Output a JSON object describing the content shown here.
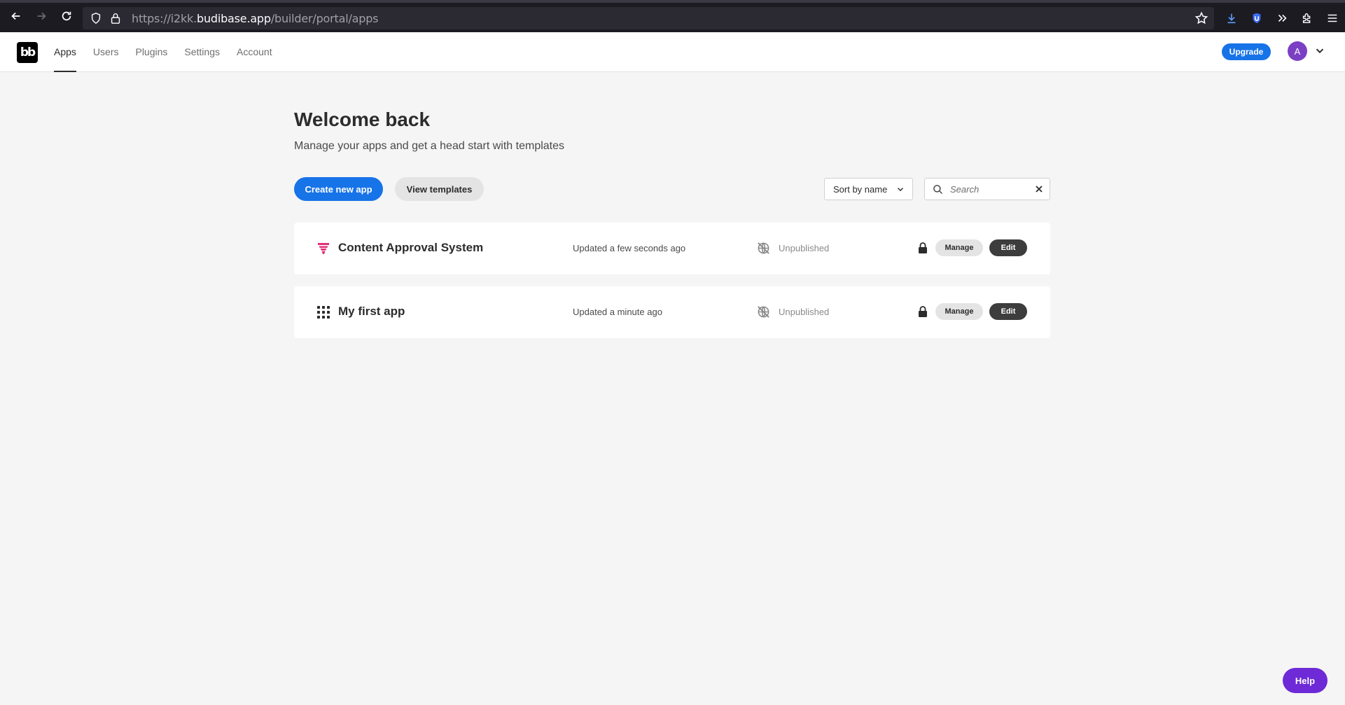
{
  "browser": {
    "url_prefix": "https://i2kk.",
    "url_host": "budibase.app",
    "url_path": "/builder/portal/apps"
  },
  "nav": {
    "logo_text": "bb",
    "items": [
      {
        "label": "Apps",
        "active": true
      },
      {
        "label": "Users",
        "active": false
      },
      {
        "label": "Plugins",
        "active": false
      },
      {
        "label": "Settings",
        "active": false
      },
      {
        "label": "Account",
        "active": false
      }
    ],
    "upgrade_label": "Upgrade",
    "avatar_initial": "A"
  },
  "page": {
    "title": "Welcome back",
    "subtitle": "Manage your apps and get a head start with templates",
    "create_label": "Create new app",
    "templates_label": "View templates",
    "sort_label": "Sort by name",
    "search_placeholder": "Search"
  },
  "apps": [
    {
      "name": "Content Approval System",
      "updated": "Updated a few seconds ago",
      "status": "Unpublished",
      "icon": "funnel-icon",
      "icon_color": "#e0317b",
      "manage_label": "Manage",
      "edit_label": "Edit"
    },
    {
      "name": "My first app",
      "updated": "Updated a minute ago",
      "status": "Unpublished",
      "icon": "grid-dots-icon",
      "icon_color": "#2c2c2c",
      "manage_label": "Manage",
      "edit_label": "Edit"
    }
  ],
  "help_label": "Help",
  "colors": {
    "accent": "#1773e8",
    "help": "#6d2ad6",
    "avatar": "#7b3fc4"
  }
}
